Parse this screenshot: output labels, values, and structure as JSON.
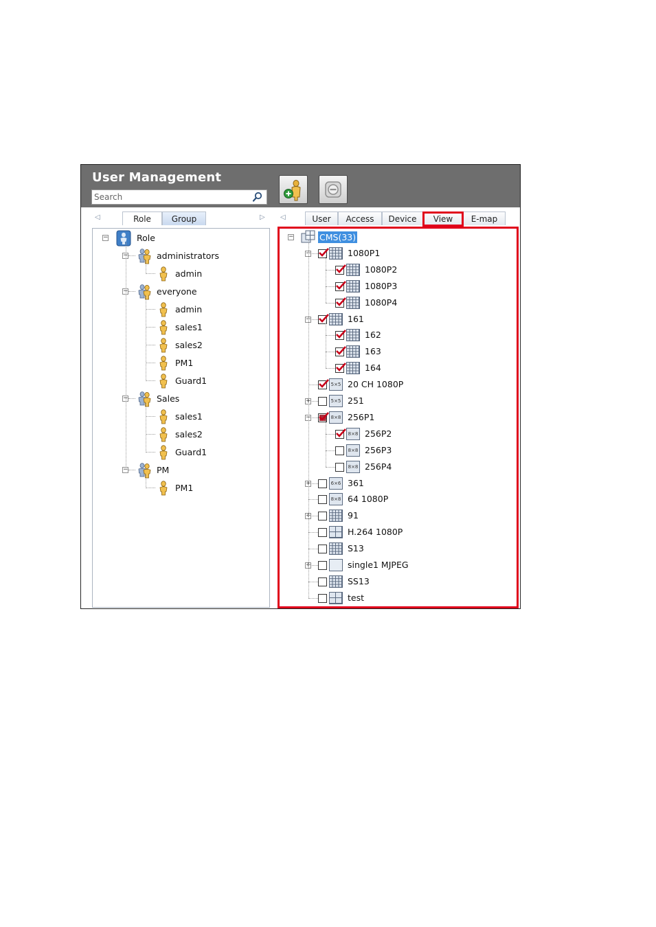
{
  "window": {
    "title": "User Management"
  },
  "search": {
    "placeholder": "Search"
  },
  "toolbar": {
    "add_user": "add-user",
    "remove": "remove"
  },
  "left_tabs": [
    {
      "label": "Role",
      "active": true
    },
    {
      "label": "Group",
      "active": false
    }
  ],
  "right_tabs": [
    {
      "label": "User"
    },
    {
      "label": "Access"
    },
    {
      "label": "Device"
    },
    {
      "label": "View",
      "highlighted": true
    },
    {
      "label": "E-map"
    }
  ],
  "role_tree": {
    "root": "Role",
    "groups": [
      {
        "name": "administrators",
        "members": [
          "admin"
        ]
      },
      {
        "name": "everyone",
        "members": [
          "admin",
          "sales1",
          "sales2",
          "PM1",
          "Guard1"
        ]
      },
      {
        "name": "Sales",
        "members": [
          "sales1",
          "sales2",
          "Guard1"
        ]
      },
      {
        "name": "PM",
        "members": [
          "PM1"
        ]
      }
    ]
  },
  "view_tree": {
    "root": "CMS(33)",
    "items": [
      {
        "label": "1080P1",
        "checked": true,
        "layout": "grid",
        "expand": "minus",
        "level": 1
      },
      {
        "label": "1080P2",
        "checked": true,
        "layout": "grid",
        "level": 2
      },
      {
        "label": "1080P3",
        "checked": true,
        "layout": "grid",
        "level": 2
      },
      {
        "label": "1080P4",
        "checked": true,
        "layout": "grid",
        "level": 2
      },
      {
        "label": "161",
        "checked": true,
        "layout": "grid",
        "expand": "minus",
        "level": 1
      },
      {
        "label": "162",
        "checked": true,
        "layout": "grid",
        "level": 2
      },
      {
        "label": "163",
        "checked": true,
        "layout": "grid",
        "level": 2
      },
      {
        "label": "164",
        "checked": true,
        "layout": "grid",
        "level": 2
      },
      {
        "label": "20 CH 1080P",
        "checked": true,
        "layout": "5x5",
        "level": 1
      },
      {
        "label": "251",
        "checked": false,
        "layout": "5x5",
        "expand": "plus",
        "level": 1
      },
      {
        "label": "256P1",
        "checked": "partial",
        "layout": "8x8",
        "expand": "minus",
        "level": 1
      },
      {
        "label": "256P2",
        "checked": true,
        "layout": "8x8",
        "level": 2
      },
      {
        "label": "256P3",
        "checked": false,
        "layout": "8x8",
        "level": 2
      },
      {
        "label": "256P4",
        "checked": false,
        "layout": "8x8",
        "level": 2
      },
      {
        "label": "361",
        "checked": false,
        "layout": "6x6",
        "expand": "plus",
        "level": 1
      },
      {
        "label": "64 1080P",
        "checked": false,
        "layout": "8x8",
        "level": 1
      },
      {
        "label": "91",
        "checked": false,
        "layout": "grid",
        "expand": "plus",
        "level": 1
      },
      {
        "label": "H.264 1080P",
        "checked": false,
        "layout": "quad",
        "level": 1
      },
      {
        "label": "S13",
        "checked": false,
        "layout": "grid",
        "level": 1
      },
      {
        "label": "single1 MJPEG",
        "checked": false,
        "layout": "single",
        "expand": "plus",
        "level": 1
      },
      {
        "label": "SS13",
        "checked": false,
        "layout": "grid",
        "level": 1
      },
      {
        "label": "test",
        "checked": false,
        "layout": "quad",
        "level": 1
      }
    ]
  },
  "colors": {
    "header": "#6e6e6e",
    "highlight": "#e0001b",
    "selection": "#3f8fe0",
    "check": "#c8001a"
  }
}
